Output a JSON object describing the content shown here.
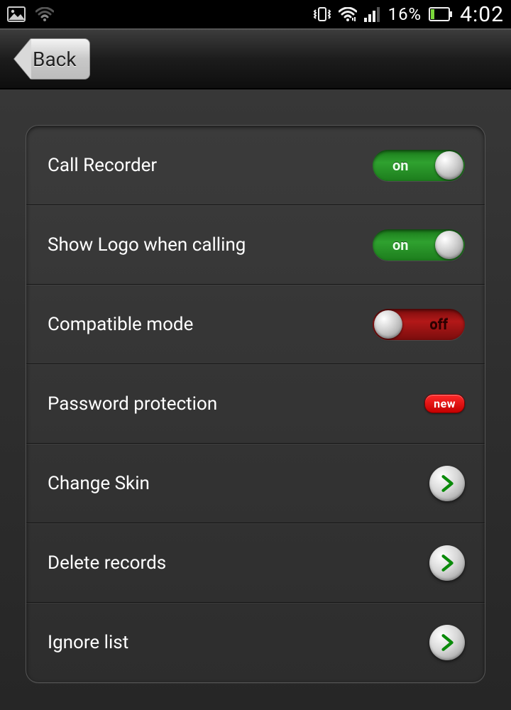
{
  "status": {
    "battery_pct": "16%",
    "clock": "4:02"
  },
  "nav": {
    "back_label": "Back"
  },
  "toggle_labels": {
    "on": "on",
    "off": "off"
  },
  "settings": {
    "call_recorder": {
      "label": "Call Recorder",
      "state": "on"
    },
    "show_logo": {
      "label": "Show Logo when calling",
      "state": "on"
    },
    "compatible_mode": {
      "label": "Compatible mode",
      "state": "off"
    },
    "password": {
      "label": "Password protection",
      "badge": "new"
    },
    "change_skin": {
      "label": "Change Skin"
    },
    "delete_records": {
      "label": "Delete records"
    },
    "ignore_list": {
      "label": "Ignore list"
    }
  }
}
